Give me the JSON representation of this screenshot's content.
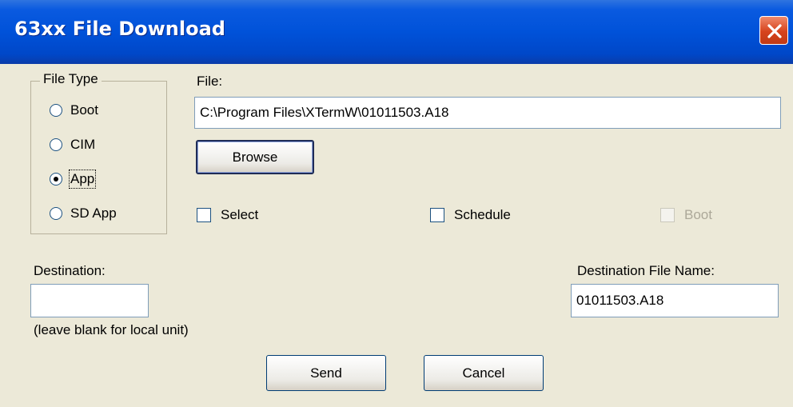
{
  "window": {
    "title": "63xx File Download"
  },
  "file_type": {
    "legend": "File Type",
    "options": [
      {
        "label": "Boot",
        "selected": false
      },
      {
        "label": "CIM",
        "selected": false
      },
      {
        "label": "App",
        "selected": true
      },
      {
        "label": "SD App",
        "selected": false
      }
    ]
  },
  "file": {
    "label": "File:",
    "value": "C:\\Program Files\\XTermW\\01011503.A18"
  },
  "browse_label": "Browse",
  "checkboxes": [
    {
      "label": "Select",
      "checked": false,
      "enabled": true
    },
    {
      "label": "Schedule",
      "checked": false,
      "enabled": true
    },
    {
      "label": "Boot",
      "checked": false,
      "enabled": false
    }
  ],
  "destination": {
    "label": "Destination:",
    "value": "",
    "hint": "(leave blank for local unit)"
  },
  "dest_file_name": {
    "label": "Destination File Name:",
    "value": "01011503.A18"
  },
  "buttons": {
    "send": "Send",
    "cancel": "Cancel"
  }
}
